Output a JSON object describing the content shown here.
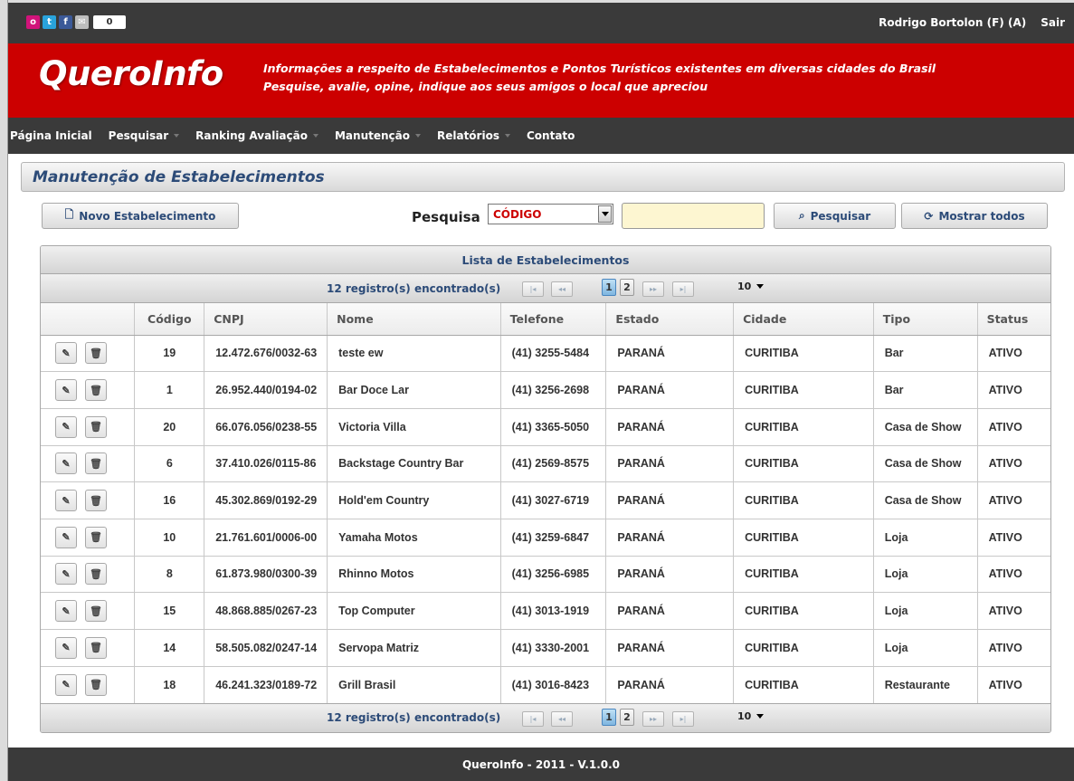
{
  "topbar": {
    "counter": "0",
    "user": "Rodrigo Bortolon (F) (A)",
    "logout": "Sair"
  },
  "banner": {
    "logo": "QueroInfo",
    "tagline1": "Informações a respeito de Estabelecimentos e Pontos Turísticos existentes em diversas cidades do Brasil",
    "tagline2": "Pesquise, avalie, opine, indique aos seus amigos o local que apreciou"
  },
  "nav": [
    "Página Inicial",
    "Pesquisar",
    "Ranking Avaliação",
    "Manutenção",
    "Relatórios",
    "Contato"
  ],
  "page_title": "Manutenção de Estabelecimentos",
  "toolbar": {
    "new_label": "Novo Estabelecimento",
    "search_label": "Pesquisa",
    "search_field": "CÓDIGO",
    "search_value": "",
    "search_button": "Pesquisar",
    "show_all_button": "Mostrar todos"
  },
  "list": {
    "title": "Lista de Estabelecimentos",
    "count_text": "12 registro(s) encontrado(s)",
    "pages": [
      "1",
      "2"
    ],
    "page_size": "10",
    "columns": [
      "",
      "Código",
      "CNPJ",
      "Nome",
      "Telefone",
      "Estado",
      "Cidade",
      "Tipo",
      "Status"
    ],
    "rows": [
      {
        "codigo": "19",
        "cnpj": "12.472.676/0032-63",
        "nome": "teste ew",
        "telefone": "(41) 3255-5484",
        "estado": "PARANÁ",
        "cidade": "CURITIBA",
        "tipo": "Bar",
        "status": "ATIVO"
      },
      {
        "codigo": "1",
        "cnpj": "26.952.440/0194-02",
        "nome": "Bar Doce Lar",
        "telefone": "(41) 3256-2698",
        "estado": "PARANÁ",
        "cidade": "CURITIBA",
        "tipo": "Bar",
        "status": "ATIVO"
      },
      {
        "codigo": "20",
        "cnpj": "66.076.056/0238-55",
        "nome": "Victoria Villa",
        "telefone": "(41) 3365-5050",
        "estado": "PARANÁ",
        "cidade": "CURITIBA",
        "tipo": "Casa de Show",
        "status": "ATIVO"
      },
      {
        "codigo": "6",
        "cnpj": "37.410.026/0115-86",
        "nome": "Backstage Country Bar",
        "telefone": "(41) 2569-8575",
        "estado": "PARANÁ",
        "cidade": "CURITIBA",
        "tipo": "Casa de Show",
        "status": "ATIVO"
      },
      {
        "codigo": "16",
        "cnpj": "45.302.869/0192-29",
        "nome": "Hold'em Country",
        "telefone": "(41) 3027-6719",
        "estado": "PARANÁ",
        "cidade": "CURITIBA",
        "tipo": "Casa de Show",
        "status": "ATIVO"
      },
      {
        "codigo": "10",
        "cnpj": "21.761.601/0006-00",
        "nome": "Yamaha Motos",
        "telefone": "(41) 3259-6847",
        "estado": "PARANÁ",
        "cidade": "CURITIBA",
        "tipo": "Loja",
        "status": "ATIVO"
      },
      {
        "codigo": "8",
        "cnpj": "61.873.980/0300-39",
        "nome": "Rhinno Motos",
        "telefone": "(41) 3256-6985",
        "estado": "PARANÁ",
        "cidade": "CURITIBA",
        "tipo": "Loja",
        "status": "ATIVO"
      },
      {
        "codigo": "15",
        "cnpj": "48.868.885/0267-23",
        "nome": "Top Computer",
        "telefone": "(41) 3013-1919",
        "estado": "PARANÁ",
        "cidade": "CURITIBA",
        "tipo": "Loja",
        "status": "ATIVO"
      },
      {
        "codigo": "14",
        "cnpj": "58.505.082/0247-14",
        "nome": "Servopa Matriz",
        "telefone": "(41) 3330-2001",
        "estado": "PARANÁ",
        "cidade": "CURITIBA",
        "tipo": "Loja",
        "status": "ATIVO"
      },
      {
        "codigo": "18",
        "cnpj": "46.241.323/0189-72",
        "nome": "Grill Brasil",
        "telefone": "(41) 3016-8423",
        "estado": "PARANÁ",
        "cidade": "CURITIBA",
        "tipo": "Restaurante",
        "status": "ATIVO"
      }
    ]
  },
  "footer": "QueroInfo - 2011 - V.1.0.0",
  "colors": {
    "brand_red": "#cc0000",
    "dark_bar": "#3a3a3a",
    "title_blue": "#2c4b78"
  }
}
